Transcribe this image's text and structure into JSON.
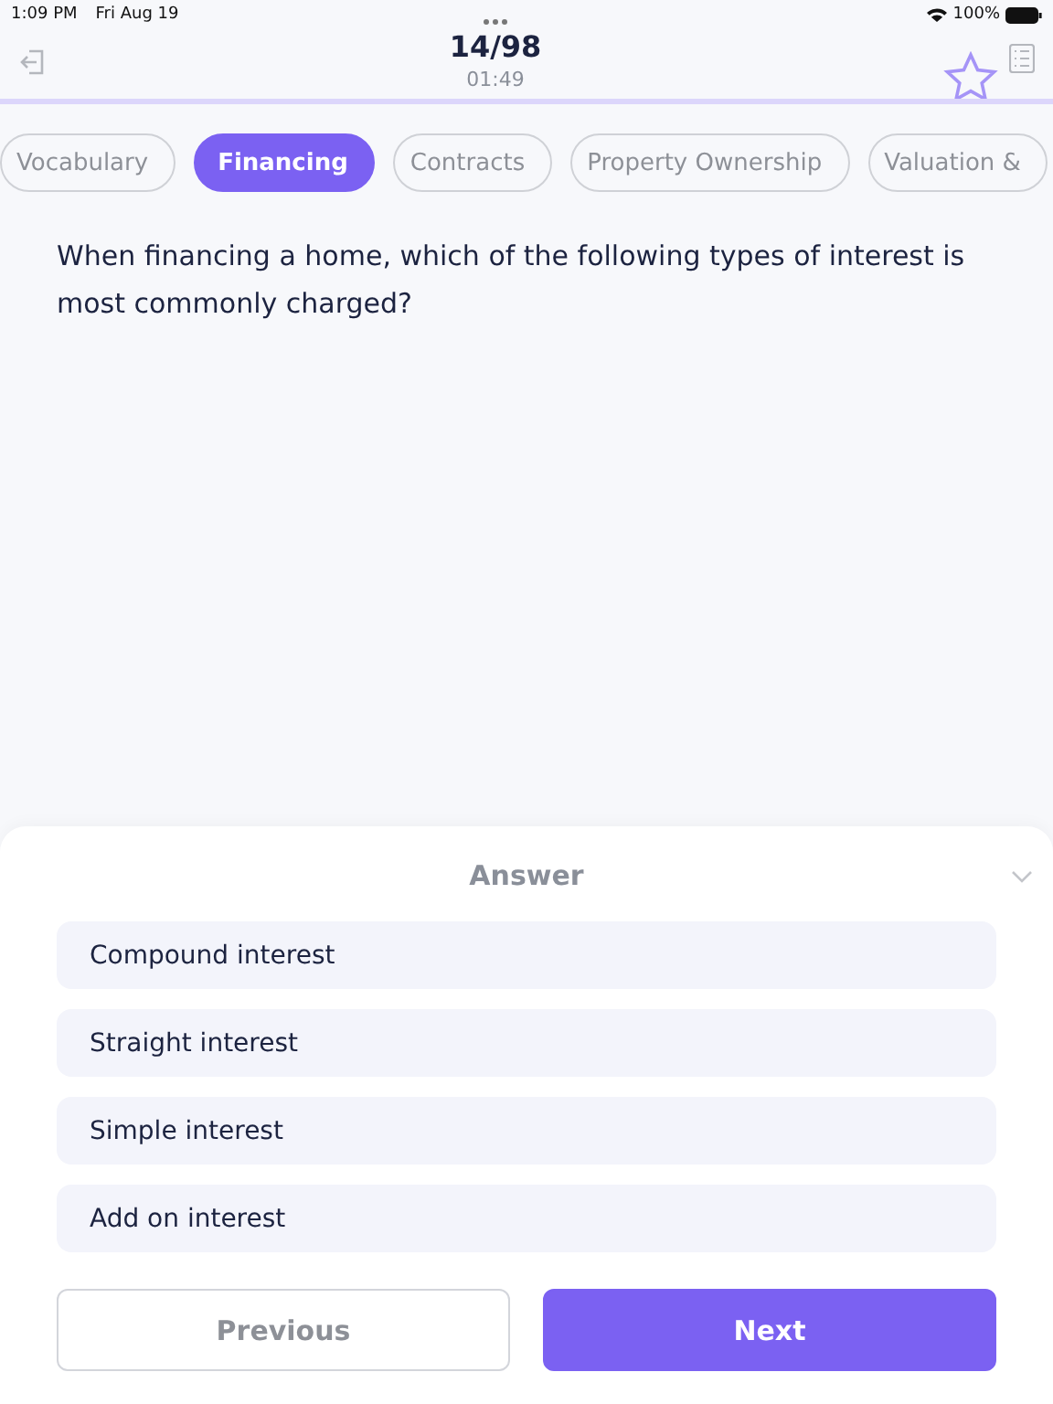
{
  "status_bar": {
    "time": "1:09 PM",
    "date": "Fri Aug 19",
    "battery": "100%"
  },
  "header": {
    "progress": "14/98",
    "timer": "01:49",
    "starred": false
  },
  "tabs": [
    {
      "label": "Vocabulary",
      "selected": false
    },
    {
      "label": "Financing",
      "selected": true
    },
    {
      "label": "Contracts",
      "selected": false
    },
    {
      "label": "Property Ownership",
      "selected": false
    },
    {
      "label": "Valuation &",
      "selected": false
    }
  ],
  "question": "When financing a home, which of the following types of interest is most commonly charged?",
  "answer_panel": {
    "title": "Answer",
    "options": [
      {
        "label": "Compound interest",
        "selected": false
      },
      {
        "label": "Straight interest",
        "selected": false
      },
      {
        "label": "Simple interest",
        "selected": false
      },
      {
        "label": "Add on interest",
        "selected": false
      }
    ]
  },
  "buttons": {
    "previous": "Previous",
    "next": "Next"
  }
}
